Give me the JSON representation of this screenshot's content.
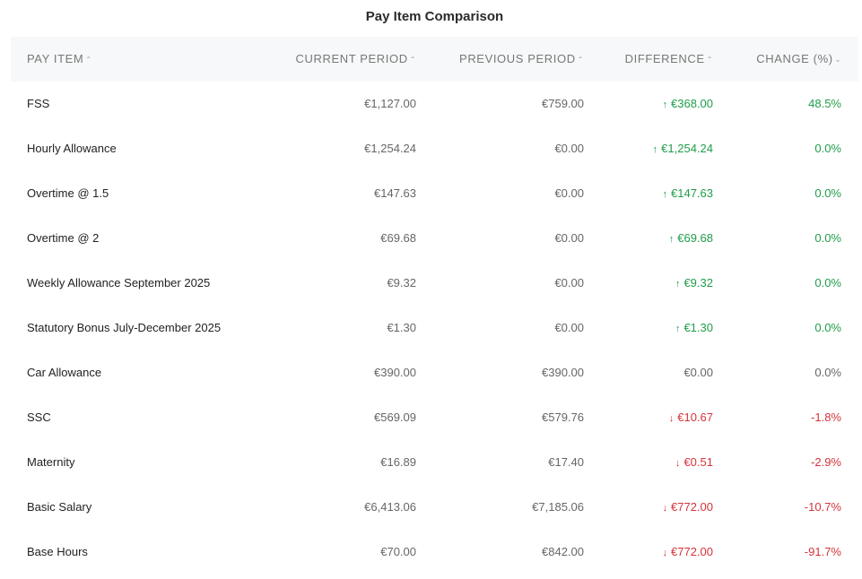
{
  "title": "Pay Item Comparison",
  "headers": {
    "pay_item": "PAY ITEM",
    "current_period": "CURRENT PERIOD",
    "previous_period": "PREVIOUS PERIOD",
    "difference": "DIFFERENCE",
    "change": "CHANGE (%)"
  },
  "sort_icons": {
    "pay_item": "⌃",
    "current_period": "⌃",
    "previous_period": "⌃",
    "difference": "⌃",
    "change": "⌄"
  },
  "colors": {
    "increase": "#1f9d4a",
    "decrease": "#d6333a",
    "neutral": "#666666",
    "header_bg": "#f7f8f9"
  },
  "rows": [
    {
      "name": "FSS",
      "current": "€1,127.00",
      "previous": "€759.00",
      "difference": "€368.00",
      "change": "48.5%",
      "trend": "up",
      "arrow": "↑"
    },
    {
      "name": "Hourly Allowance",
      "current": "€1,254.24",
      "previous": "€0.00",
      "difference": "€1,254.24",
      "change": "0.0%",
      "trend": "up",
      "arrow": "↑"
    },
    {
      "name": "Overtime @ 1.5",
      "current": "€147.63",
      "previous": "€0.00",
      "difference": "€147.63",
      "change": "0.0%",
      "trend": "up",
      "arrow": "↑"
    },
    {
      "name": "Overtime @ 2",
      "current": "€69.68",
      "previous": "€0.00",
      "difference": "€69.68",
      "change": "0.0%",
      "trend": "up",
      "arrow": "↑"
    },
    {
      "name": "Weekly Allowance September 2025",
      "current": "€9.32",
      "previous": "€0.00",
      "difference": "€9.32",
      "change": "0.0%",
      "trend": "up",
      "arrow": "↑"
    },
    {
      "name": "Statutory Bonus July-December 2025",
      "current": "€1.30",
      "previous": "€0.00",
      "difference": "€1.30",
      "change": "0.0%",
      "trend": "up",
      "arrow": "↑"
    },
    {
      "name": "Car Allowance",
      "current": "€390.00",
      "previous": "€390.00",
      "difference": "€0.00",
      "change": "0.0%",
      "trend": "neutral",
      "arrow": ""
    },
    {
      "name": "SSC",
      "current": "€569.09",
      "previous": "€579.76",
      "difference": "€10.67",
      "change": "-1.8%",
      "trend": "down",
      "arrow": "↓"
    },
    {
      "name": "Maternity",
      "current": "€16.89",
      "previous": "€17.40",
      "difference": "€0.51",
      "change": "-2.9%",
      "trend": "down",
      "arrow": "↓"
    },
    {
      "name": "Basic Salary",
      "current": "€6,413.06",
      "previous": "€7,185.06",
      "difference": "€772.00",
      "change": "-10.7%",
      "trend": "down",
      "arrow": "↓"
    },
    {
      "name": "Base Hours",
      "current": "€70.00",
      "previous": "€842.00",
      "difference": "€772.00",
      "change": "-91.7%",
      "trend": "down",
      "arrow": "↓"
    }
  ]
}
